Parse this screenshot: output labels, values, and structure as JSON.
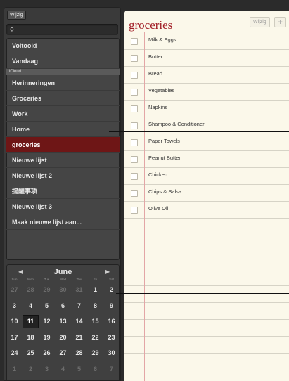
{
  "left_panel": {
    "edit_label": "Wijzig",
    "search_icon": "magnifier-icon",
    "lists_top": [
      {
        "label": "Voltooid",
        "selected": false
      },
      {
        "label": "Vandaag",
        "selected": false
      }
    ],
    "section_label": "iCloud",
    "lists_icloud": [
      {
        "label": "Herinneringen",
        "selected": false
      },
      {
        "label": "Groceries",
        "selected": false
      },
      {
        "label": "Work",
        "selected": false
      },
      {
        "label": "Home",
        "selected": false
      },
      {
        "label": "groceries",
        "selected": true
      },
      {
        "label": "Nieuwe lijst",
        "selected": false
      },
      {
        "label": "Nieuwe lijst 2",
        "selected": false
      },
      {
        "label": "提醒事项",
        "selected": false
      },
      {
        "label": "Nieuwe lijst 3",
        "selected": false
      },
      {
        "label": "Maak nieuwe lijst aan...",
        "selected": false
      }
    ]
  },
  "calendar": {
    "month": "June",
    "prev_icon": "triangle-left-icon",
    "next_icon": "triangle-right-icon",
    "weekdays": [
      "Sun",
      "Mon",
      "Tue",
      "Wed",
      "Thu",
      "Fri",
      "Sat"
    ],
    "weeks": [
      [
        "27",
        "28",
        "29",
        "30",
        "31",
        "1",
        "2"
      ],
      [
        "3",
        "4",
        "5",
        "6",
        "7",
        "8",
        "9"
      ],
      [
        "10",
        "11",
        "12",
        "13",
        "14",
        "15",
        "16"
      ],
      [
        "17",
        "18",
        "19",
        "20",
        "21",
        "22",
        "23"
      ],
      [
        "24",
        "25",
        "26",
        "27",
        "28",
        "29",
        "30"
      ],
      [
        "1",
        "2",
        "3",
        "4",
        "5",
        "6",
        "7"
      ]
    ],
    "today": "11"
  },
  "right_panel": {
    "title": "groceries",
    "edit_label": "Wijzig",
    "add_label": "+",
    "items": [
      "Milk & Eggs",
      "Butter",
      "Bread",
      "Vegetables",
      "Napkins",
      "Shampoo & Conditioner",
      "Paper Towels",
      "Peanut Butter",
      "Chicken",
      "Chips & Salsa",
      "Olive Oil"
    ]
  }
}
